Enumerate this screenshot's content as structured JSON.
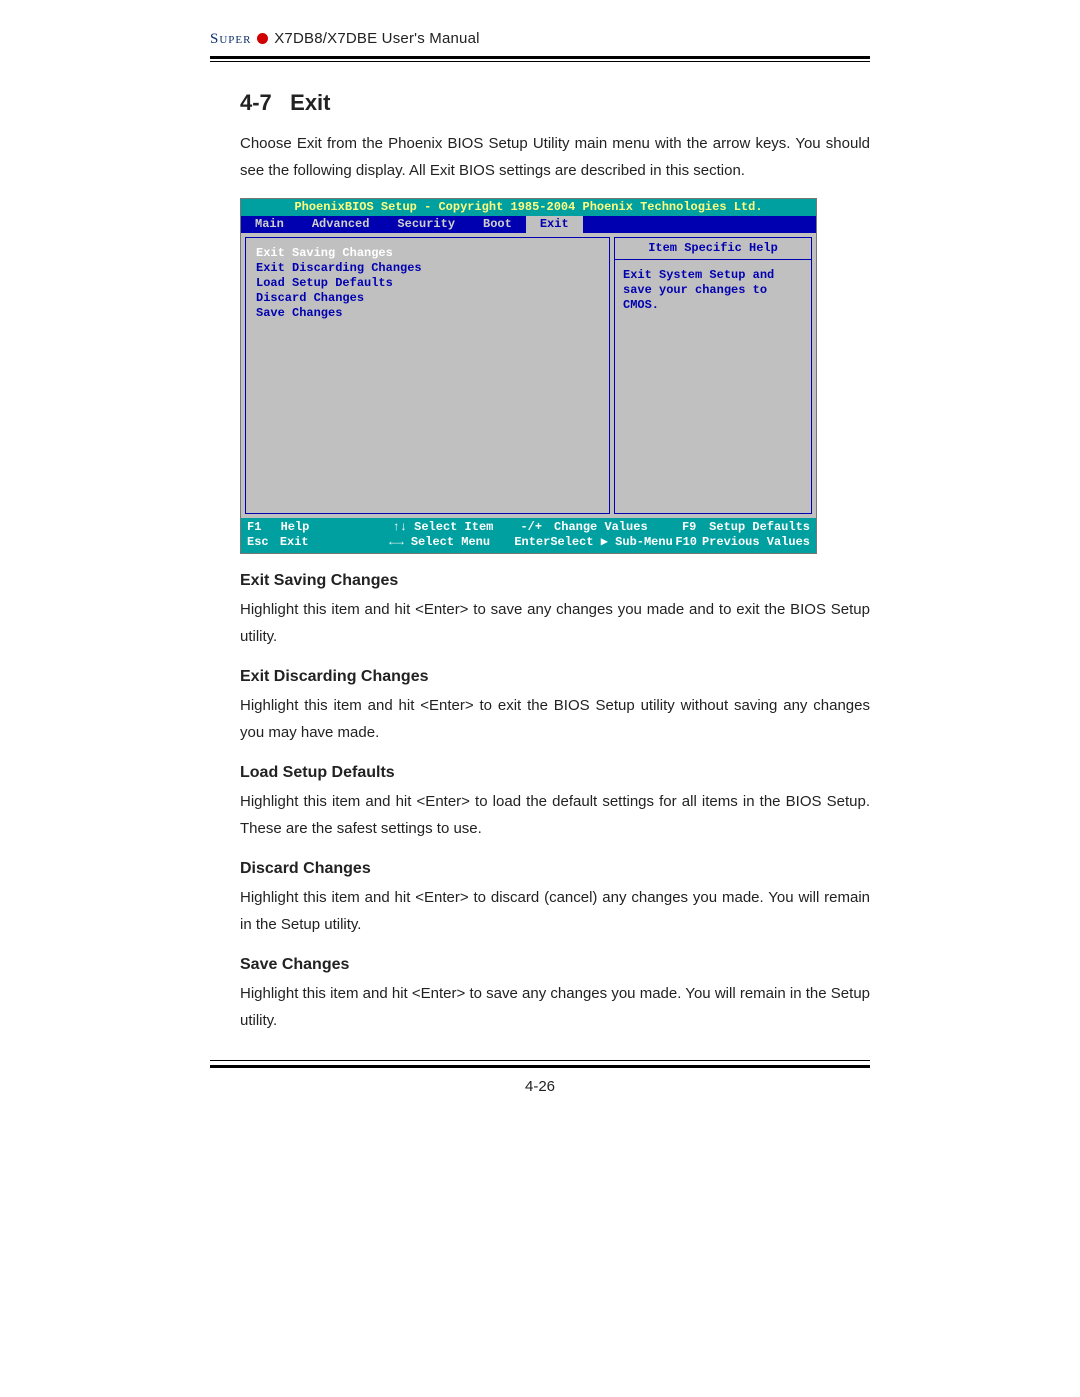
{
  "header": {
    "brand": "Super",
    "manual_title": "X7DB8/X7DBE User's Manual"
  },
  "section": {
    "number": "4-7",
    "title": "Exit",
    "intro": "Choose Exit from the Phoenix BIOS Setup Utility main menu with the arrow keys. You should see the following display.  All Exit BIOS settings are described in this section."
  },
  "bios": {
    "title": "PhoenixBIOS Setup - Copyright 1985-2004 Phoenix Technologies Ltd.",
    "tabs": [
      "Main",
      "Advanced",
      "Security",
      "Boot",
      "Exit"
    ],
    "active_tab_index": 4,
    "menu_items": [
      "Exit Saving Changes",
      "Exit Discarding Changes",
      "Load Setup Defaults",
      "Discard Changes",
      "Save Changes"
    ],
    "selected_menu_index": 0,
    "help": {
      "title": "Item Specific Help",
      "body": "Exit System Setup and save your changes to CMOS."
    },
    "footer": {
      "line1": {
        "k1": "F1",
        "a1": "Help",
        "k2": "↑↓ Select Item",
        "k3": "-/+",
        "a3": "Change Values",
        "k4": "F9",
        "a4": "Setup Defaults"
      },
      "line2": {
        "k1": "Esc",
        "a1": "Exit",
        "k2": "←→ Select Menu",
        "k3": "Enter",
        "a3": "Select ▶ Sub-Menu",
        "k4": "F10",
        "a4": "Previous Values"
      }
    }
  },
  "subsections": [
    {
      "title": "Exit Saving Changes",
      "body": "Highlight this item and hit <Enter> to save any changes you made and to exit the BIOS Setup utility."
    },
    {
      "title": "Exit Discarding Changes",
      "body": "Highlight this item and hit <Enter> to exit the BIOS Setup utility without saving any changes you may have made."
    },
    {
      "title": "Load Setup Defaults",
      "body": "Highlight this item and hit <Enter> to load the default settings for all items in the BIOS Setup.  These are the safest settings to use."
    },
    {
      "title": "Discard Changes",
      "body": "Highlight this item and hit <Enter> to discard (cancel) any changes you  made. You will remain in the Setup utility."
    },
    {
      "title": "Save Changes",
      "body": "Highlight this item and hit <Enter> to save any changes you made.  You will remain in the Setup utility."
    }
  ],
  "page_number": "4-26"
}
